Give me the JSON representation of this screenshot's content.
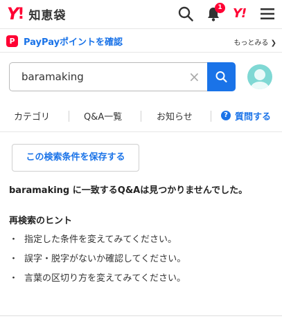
{
  "header": {
    "logo_y": "Y",
    "logo_bang": "!",
    "logo_text": "知恵袋",
    "notification_count": "1",
    "yahoo_mark": "Y!"
  },
  "paypay": {
    "icon_label": "P",
    "label": "PayPayポイントを確認",
    "more": "もっとみる ❯"
  },
  "search": {
    "value": "baramaking",
    "clear_glyph": "×"
  },
  "nav": {
    "items": [
      "カテゴリ",
      "Q&A一覧",
      "お知らせ"
    ],
    "ask_icon": "?",
    "ask_label": "質問する"
  },
  "main": {
    "save_button": "この検索条件を保存する",
    "no_result": "baramaking に一致するQ&Aは見つかりませんでした。",
    "hint_title": "再検索のヒント",
    "hints": [
      "指定した条件を変えてみてください。",
      "誤字・脱字がないか確認してください。",
      "言葉の区切り方を変えてみてください。"
    ]
  },
  "colors": {
    "brand_red": "#ff0033",
    "accent_blue": "#1a73e8",
    "avatar_teal": "#7fd8d4"
  },
  "icons": [
    "search-icon",
    "bell-icon",
    "hamburger-icon",
    "clear-icon",
    "question-icon",
    "avatar-icon"
  ]
}
